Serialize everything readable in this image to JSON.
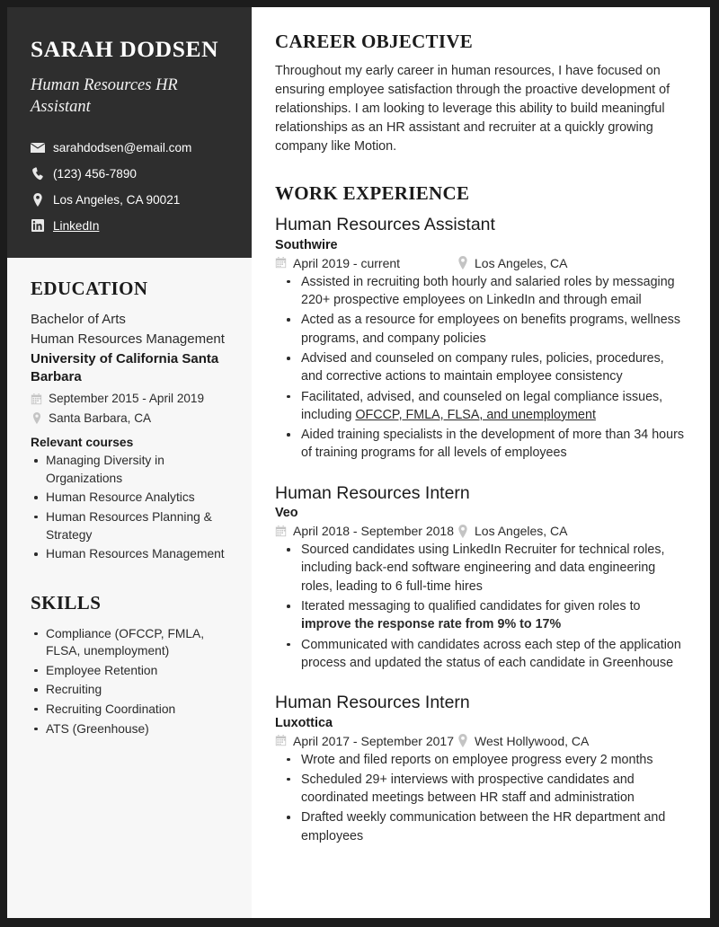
{
  "candidate": {
    "name": "SARAH DODSEN",
    "title": "Human Resources HR Assistant",
    "contacts": [
      {
        "icon": "envelope-icon",
        "text": "sarahdodsen@email.com",
        "link": false
      },
      {
        "icon": "phone-icon",
        "text": "(123) 456-7890",
        "link": false
      },
      {
        "icon": "map-pin-icon",
        "text": "Los Angeles, CA 90021",
        "link": false
      },
      {
        "icon": "linkedin-icon",
        "text": "LinkedIn",
        "link": true
      }
    ]
  },
  "sidebar": {
    "education_heading": "EDUCATION",
    "education": {
      "degree": "Bachelor of Arts",
      "major": "Human Resources Management",
      "school": "University of California Santa Barbara",
      "dates": "September 2015 - April 2019",
      "location": "Santa Barbara, CA",
      "courses_label": "Relevant courses",
      "courses": [
        "Managing Diversity in Organizations",
        "Human Resource Analytics",
        "Human Resources Planning & Strategy",
        "Human Resources Management"
      ]
    },
    "skills_heading": "SKILLS",
    "skills": [
      "Compliance (OFCCP, FMLA, FLSA, unemployment)",
      "Employee Retention",
      "Recruiting",
      "Recruiting Coordination",
      "ATS (Greenhouse)"
    ]
  },
  "main": {
    "objective_heading": "CAREER OBJECTIVE",
    "objective_text": "Throughout my early career in human resources, I have focused on ensuring employee satisfaction through the proactive development of relationships. I am looking to leverage this ability to build meaningful relationships as an HR assistant and recruiter at a quickly growing company like Motion.",
    "experience_heading": "WORK EXPERIENCE",
    "jobs": [
      {
        "title": "Human Resources Assistant",
        "company": "Southwire",
        "dates": "April 2019 - current",
        "location": "Los Angeles, CA",
        "bullets": [
          {
            "pre": "Assisted in recruiting both hourly and salaried roles by messaging 220+ prospective employees on LinkedIn and through email",
            "emph": "",
            "emph_style": "",
            "post": ""
          },
          {
            "pre": "Acted as a resource for employees on benefits programs, wellness programs, and company policies",
            "emph": "",
            "emph_style": "",
            "post": ""
          },
          {
            "pre": "Advised and counseled on company rules, policies, procedures, and corrective actions to maintain employee consistency",
            "emph": "",
            "emph_style": "",
            "post": ""
          },
          {
            "pre": "Facilitated, advised, and counseled on legal compliance issues, including ",
            "emph": "OFCCP, FMLA, FLSA, and unemployment",
            "emph_style": "underline",
            "post": ""
          },
          {
            "pre": "Aided training specialists in the development of more than 34 hours of training programs for all levels of employees",
            "emph": "",
            "emph_style": "",
            "post": ""
          }
        ]
      },
      {
        "title": "Human Resources Intern",
        "company": "Veo",
        "dates": "April 2018 - September 2018",
        "location": "Los Angeles, CA",
        "bullets": [
          {
            "pre": "Sourced candidates using LinkedIn Recruiter for technical roles, including back-end software engineering and data engineering roles, leading to 6 full-time hires",
            "emph": "",
            "emph_style": "",
            "post": ""
          },
          {
            "pre": "Iterated messaging to qualified candidates for given roles to ",
            "emph": "improve the response rate from 9% to 17%",
            "emph_style": "bold",
            "post": ""
          },
          {
            "pre": "Communicated with candidates across each step of the application process and updated the status of each candidate in Greenhouse",
            "emph": "",
            "emph_style": "",
            "post": ""
          }
        ]
      },
      {
        "title": "Human Resources Intern",
        "company": "Luxottica",
        "dates": "April 2017 - September 2017",
        "location": "West Hollywood, CA",
        "bullets": [
          {
            "pre": "Wrote and filed reports on employee progress every 2 months",
            "emph": "",
            "emph_style": "",
            "post": ""
          },
          {
            "pre": "Scheduled 29+ interviews with prospective candidates and coordinated meetings between HR staff and administration",
            "emph": "",
            "emph_style": "",
            "post": ""
          },
          {
            "pre": "Drafted weekly communication between the HR department and employees",
            "emph": "",
            "emph_style": "",
            "post": ""
          }
        ]
      }
    ]
  },
  "theme": {
    "header_bg": "#2e2e2e",
    "sidebar_bg": "#f7f7f7",
    "page_border": "#1c1c1c",
    "text": "#2b2b2b",
    "icon_gray": "#c4c4c4"
  }
}
